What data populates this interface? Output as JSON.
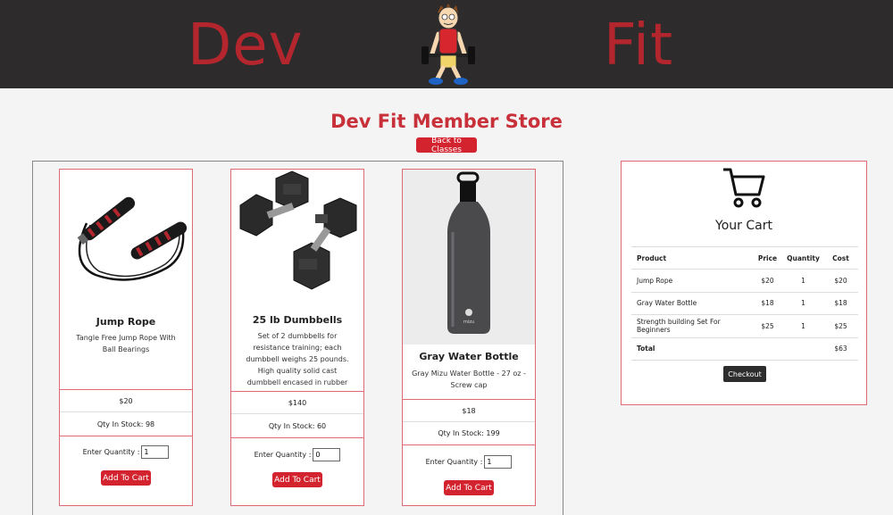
{
  "header": {
    "brand_left": "Dev",
    "brand_right": "Fit",
    "mascot_icon": "weightlifter-mascot-icon"
  },
  "page": {
    "title": "Dev Fit Member Store",
    "back_label": "Back to Classes"
  },
  "products": [
    {
      "name": "Jump Rope",
      "description": "Tangle Free Jump Rope With Ball Bearings",
      "price": "$20",
      "stock": "Qty In Stock: 98",
      "qty_label": "Enter Quantity :",
      "qty_value": "1",
      "add_label": "Add To Cart",
      "image_icon": "jump-rope-image"
    },
    {
      "name": "25 lb Dumbbells",
      "description": "Set of 2 dumbbells for resistance training; each dumbbell weighs 25 pounds. High quality solid cast dumbbell encased in rubber",
      "price": "$140",
      "stock": "Qty In Stock: 60",
      "qty_label": "Enter Quantity :",
      "qty_value": "0",
      "add_label": "Add To Cart",
      "image_icon": "dumbbells-image"
    },
    {
      "name": "Gray Water Bottle",
      "description": "Gray Mizu Water Bottle - 27 oz - Screw cap",
      "price": "$18",
      "stock": "Qty In Stock: 199",
      "qty_label": "Enter Quantity :",
      "qty_value": "1",
      "add_label": "Add To Cart",
      "image_icon": "water-bottle-image",
      "bottle_brand": "mizu"
    }
  ],
  "cart": {
    "title": "Your Cart",
    "icon": "shopping-cart-icon",
    "headers": [
      "Product",
      "Price",
      "Quantity",
      "Cost"
    ],
    "rows": [
      [
        "Jump Rope",
        "$20",
        "1",
        "$20"
      ],
      [
        "Gray Water Bottle",
        "$18",
        "1",
        "$18"
      ],
      [
        "Strength building Set For Beginners",
        "$25",
        "1",
        "$25"
      ]
    ],
    "total_label": "Total",
    "total_value": "$63",
    "checkout_label": "Checkout"
  },
  "colors": {
    "header_bg": "#2d2b2b",
    "brand_red": "#b3262e",
    "accent_red": "#d3232f",
    "card_border": "#e06a71"
  }
}
